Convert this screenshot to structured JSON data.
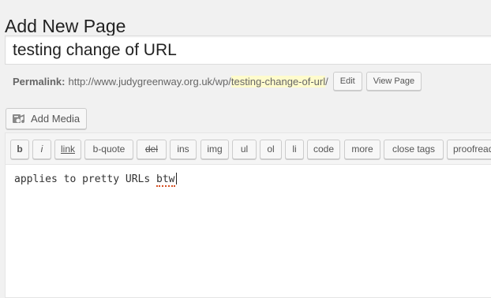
{
  "header": {
    "title": "Add New Page"
  },
  "title_field": {
    "value": "testing change of URL"
  },
  "permalink": {
    "label": "Permalink:",
    "base_url": "http://www.judygreenway.org.uk/wp/",
    "slug": "testing-change-of-url",
    "trailing": "/",
    "edit_label": "Edit",
    "view_label": "View Page"
  },
  "media": {
    "add_media_label": "Add Media",
    "icon": "media-icon"
  },
  "quicktags": [
    {
      "label": "b",
      "style": "bold"
    },
    {
      "label": "i",
      "style": "italic"
    },
    {
      "label": "link",
      "style": "underline"
    },
    {
      "label": "b-quote",
      "style": "normal"
    },
    {
      "label": "del",
      "style": "strikethrough"
    },
    {
      "label": "ins",
      "style": "normal"
    },
    {
      "label": "img",
      "style": "normal"
    },
    {
      "label": "ul",
      "style": "normal"
    },
    {
      "label": "ol",
      "style": "normal"
    },
    {
      "label": "li",
      "style": "normal"
    },
    {
      "label": "code",
      "style": "normal"
    },
    {
      "label": "more",
      "style": "normal"
    },
    {
      "label": "close tags",
      "style": "normal"
    },
    {
      "label": "proofread",
      "style": "normal"
    }
  ],
  "editor": {
    "text_before": "applies to pretty URLs ",
    "misspelled_word": "btw"
  },
  "colors": {
    "slug_highlight": "#fffbcc",
    "spellcheck_underline": "#d54e21"
  }
}
